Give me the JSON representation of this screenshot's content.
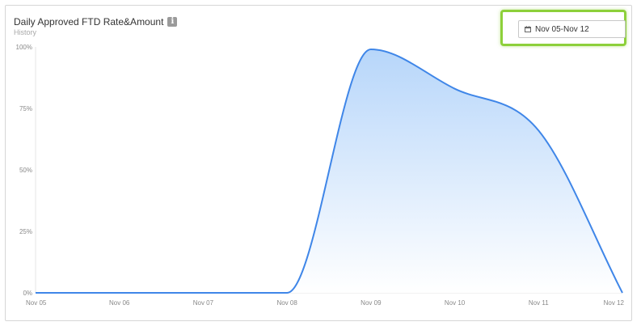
{
  "widget": {
    "title": "Daily Approved FTD Rate&Amount",
    "subtitle": "History",
    "info_icon": "info-icon"
  },
  "date_range": {
    "value": "Nov 05-Nov 12",
    "icon": "calendar-icon",
    "highlight_color": "#8dd03a"
  },
  "chart_data": {
    "type": "area",
    "title": "Daily Approved FTD Rate&Amount",
    "subtitle": "History",
    "categories": [
      "Nov 05",
      "Nov 06",
      "Nov 07",
      "Nov 08",
      "Nov 09",
      "Nov 10",
      "Nov 11",
      "Nov 12"
    ],
    "series": [
      {
        "values": [
          0,
          0,
          0,
          0,
          99,
          83,
          66,
          0
        ],
        "color": "#3f86e8",
        "fill_top": "#b7d6fa",
        "fill_bottom": "#ffffff"
      }
    ],
    "y_ticks": [
      "0%",
      "25%",
      "50%",
      "75%",
      "100%"
    ],
    "ylim": [
      0,
      100
    ],
    "grid": false,
    "legend": false
  }
}
